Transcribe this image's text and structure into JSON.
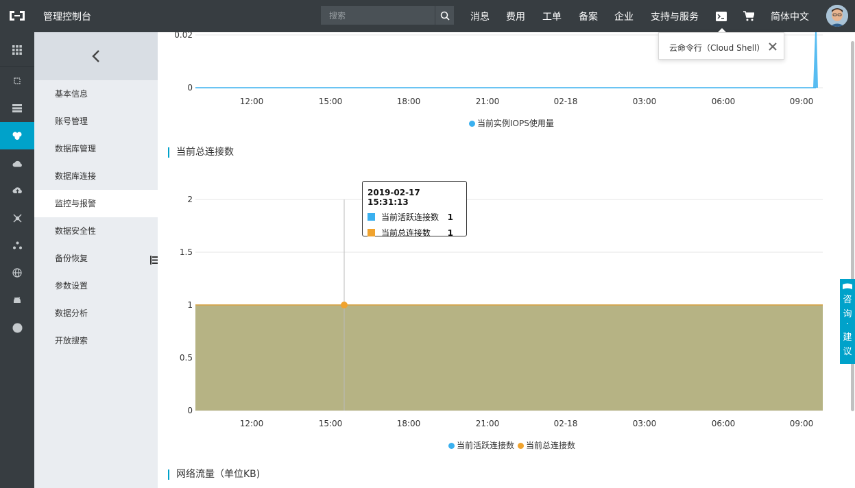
{
  "header": {
    "title": "管理控制台",
    "search_placeholder": "搜索",
    "nav": [
      "消息",
      "费用",
      "工单",
      "备案",
      "企业",
      "支持与服务"
    ],
    "language": "简体中文"
  },
  "subnav": {
    "items": [
      "基本信息",
      "账号管理",
      "数据库管理",
      "数据库连接",
      "监控与报警",
      "数据安全性",
      "备份恢复",
      "参数设置",
      "数据分析",
      "开放搜索"
    ],
    "active_index": 4
  },
  "popover": {
    "text": "云命令行（Cloud Shell）"
  },
  "consult_tab": {
    "chars": [
      "咨",
      "询",
      "·",
      "建",
      "议"
    ]
  },
  "chart_top": {
    "legend": "当前实例IOPS使用量",
    "y_ticks": [
      "0.02",
      "0"
    ],
    "x_ticks": [
      "12:00",
      "15:00",
      "18:00",
      "21:00",
      "02-18",
      "03:00",
      "06:00",
      "09:00"
    ]
  },
  "section_connections": {
    "title": "当前总连接数"
  },
  "section_network": {
    "title": "网络流量（单位KB)"
  },
  "tooltip": {
    "time": "2019-02-17 15:31:13",
    "rows": [
      {
        "label": "当前活跃连接数",
        "value": "1"
      },
      {
        "label": "当前总连接数",
        "value": "1"
      }
    ]
  },
  "chart_data": [
    {
      "type": "area",
      "x": [
        "12:00",
        "15:00",
        "18:00",
        "21:00",
        "02-18",
        "03:00",
        "06:00",
        "09:00"
      ],
      "series": [
        {
          "name": "当前实例IOPS使用量",
          "color": "#3ab0ef",
          "values": [
            0,
            0,
            0,
            0,
            0,
            0,
            0,
            0
          ],
          "end_spike": 0.02
        }
      ],
      "ylim": [
        0,
        0.02
      ],
      "y_ticks": [
        0,
        0.02
      ],
      "grid": true,
      "legend": "bottom"
    },
    {
      "type": "area",
      "x": [
        "12:00",
        "15:00",
        "18:00",
        "21:00",
        "02-18",
        "03:00",
        "06:00",
        "09:00"
      ],
      "series": [
        {
          "name": "当前活跃连接数",
          "color": "#3ab0ef",
          "values": [
            1,
            1,
            1,
            1,
            1,
            1,
            1,
            1
          ]
        },
        {
          "name": "当前总连接数",
          "color": "#f0a32e",
          "values": [
            1,
            1,
            1,
            1,
            1,
            1,
            1,
            1
          ]
        }
      ],
      "ylim": [
        0,
        2
      ],
      "y_ticks": [
        "0",
        "0.5",
        "1",
        "1.5",
        "2"
      ],
      "grid": true,
      "legend": "bottom"
    }
  ],
  "colors": {
    "topbar": "#373d41",
    "accent": "#00a2ca",
    "area_fill": "#b6b384"
  }
}
